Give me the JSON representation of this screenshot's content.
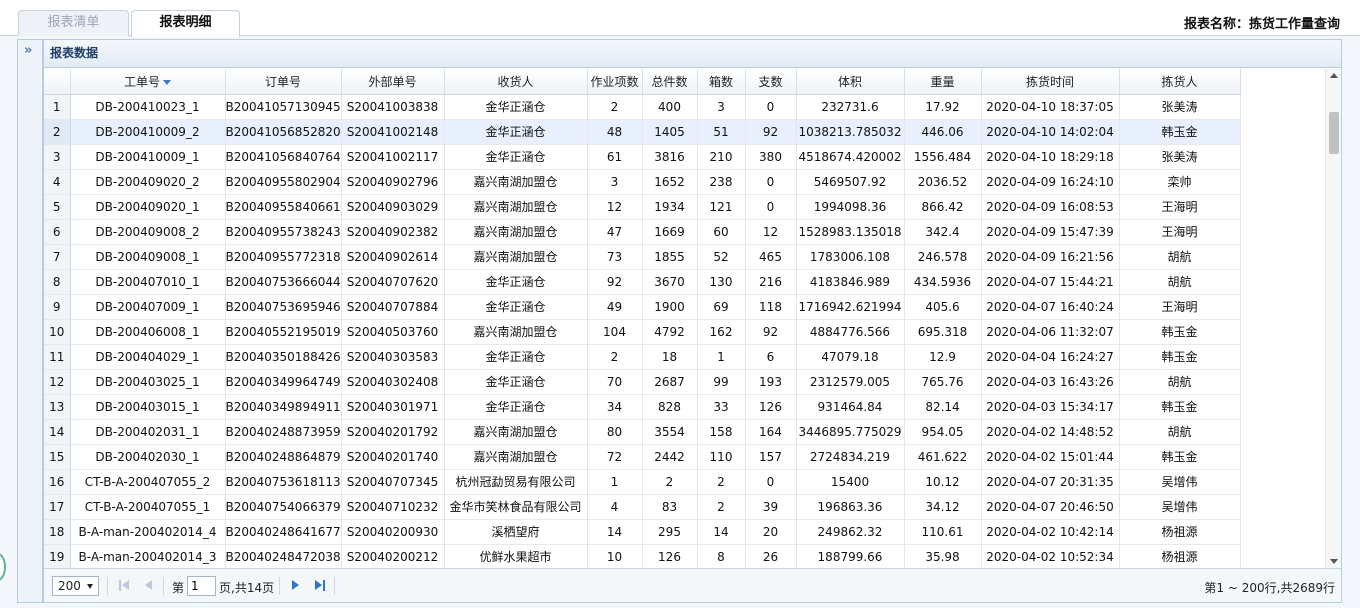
{
  "tabs": [
    {
      "label": "报表清单"
    },
    {
      "label": "报表明细"
    }
  ],
  "report_title": "报表名称：拣货工作量查询",
  "panel": {
    "title": "报表数据"
  },
  "table": {
    "headers": [
      "工单号",
      "订单号",
      "外部单号",
      "收货人",
      "作业项数",
      "总件数",
      "箱数",
      "支数",
      "体积",
      "重量",
      "拣货时间",
      "拣货人"
    ],
    "rows": [
      {
        "n": "1",
        "c": [
          "DB-200410023_1",
          "B20041057130945",
          "S20041003838",
          "金华正涵仓",
          "2",
          "400",
          "3",
          "0",
          "232731.6",
          "17.92",
          "2020-04-10 18:37:05",
          "张美涛"
        ]
      },
      {
        "n": "2",
        "c": [
          "DB-200410009_2",
          "B20041056852820",
          "S20041002148",
          "金华正涵仓",
          "48",
          "1405",
          "51",
          "92",
          "1038213.785032",
          "446.06",
          "2020-04-10 14:02:04",
          "韩玉金"
        ]
      },
      {
        "n": "3",
        "c": [
          "DB-200410009_1",
          "B20041056840764",
          "S20041002117",
          "金华正涵仓",
          "61",
          "3816",
          "210",
          "380",
          "4518674.420002",
          "1556.484",
          "2020-04-10 18:29:18",
          "张美涛"
        ]
      },
      {
        "n": "4",
        "c": [
          "DB-200409020_2",
          "B20040955802904",
          "S20040902796",
          "嘉兴南湖加盟仓",
          "3",
          "1652",
          "238",
          "0",
          "5469507.92",
          "2036.52",
          "2020-04-09 16:24:10",
          "栾帅"
        ]
      },
      {
        "n": "5",
        "c": [
          "DB-200409020_1",
          "B20040955840661",
          "S20040903029",
          "嘉兴南湖加盟仓",
          "12",
          "1934",
          "121",
          "0",
          "1994098.36",
          "866.42",
          "2020-04-09 16:08:53",
          "王海明"
        ]
      },
      {
        "n": "6",
        "c": [
          "DB-200409008_2",
          "B20040955738243",
          "S20040902382",
          "嘉兴南湖加盟仓",
          "47",
          "1669",
          "60",
          "12",
          "1528983.135018",
          "342.4",
          "2020-04-09 15:47:39",
          "王海明"
        ]
      },
      {
        "n": "7",
        "c": [
          "DB-200409008_1",
          "B20040955772318",
          "S20040902614",
          "嘉兴南湖加盟仓",
          "73",
          "1855",
          "52",
          "465",
          "1783006.108",
          "246.578",
          "2020-04-09 16:21:56",
          "胡航"
        ]
      },
      {
        "n": "8",
        "c": [
          "DB-200407010_1",
          "B20040753666044",
          "S20040707620",
          "金华正涵仓",
          "92",
          "3670",
          "130",
          "216",
          "4183846.989",
          "434.5936",
          "2020-04-07 15:44:21",
          "胡航"
        ]
      },
      {
        "n": "9",
        "c": [
          "DB-200407009_1",
          "B20040753695946",
          "S20040707884",
          "金华正涵仓",
          "49",
          "1900",
          "69",
          "118",
          "1716942.621994",
          "405.6",
          "2020-04-07 16:40:24",
          "王海明"
        ]
      },
      {
        "n": "10",
        "c": [
          "DB-200406008_1",
          "B20040552195019",
          "S20040503760",
          "嘉兴南湖加盟仓",
          "104",
          "4792",
          "162",
          "92",
          "4884776.566",
          "695.318",
          "2020-04-06 11:32:07",
          "韩玉金"
        ]
      },
      {
        "n": "11",
        "c": [
          "DB-200404029_1",
          "B20040350188426",
          "S20040303583",
          "金华正涵仓",
          "2",
          "18",
          "1",
          "6",
          "47079.18",
          "12.9",
          "2020-04-04 16:24:27",
          "韩玉金"
        ]
      },
      {
        "n": "12",
        "c": [
          "DB-200403025_1",
          "B20040349964749",
          "S20040302408",
          "金华正涵仓",
          "70",
          "2687",
          "99",
          "193",
          "2312579.005",
          "765.76",
          "2020-04-03 16:43:26",
          "胡航"
        ]
      },
      {
        "n": "13",
        "c": [
          "DB-200403015_1",
          "B20040349894911",
          "S20040301971",
          "金华正涵仓",
          "34",
          "828",
          "33",
          "126",
          "931464.84",
          "82.14",
          "2020-04-03 15:34:17",
          "韩玉金"
        ]
      },
      {
        "n": "14",
        "c": [
          "DB-200402031_1",
          "B20040248873959",
          "S20040201792",
          "嘉兴南湖加盟仓",
          "80",
          "3554",
          "158",
          "164",
          "3446895.775029",
          "954.05",
          "2020-04-02 14:48:52",
          "胡航"
        ]
      },
      {
        "n": "15",
        "c": [
          "DB-200402030_1",
          "B20040248864879",
          "S20040201740",
          "嘉兴南湖加盟仓",
          "72",
          "2442",
          "110",
          "157",
          "2724834.219",
          "461.622",
          "2020-04-02 15:01:44",
          "韩玉金"
        ]
      },
      {
        "n": "16",
        "c": [
          "CT-B-A-200407055_2",
          "B20040753618113",
          "S20040707345",
          "杭州冠勐贸易有限公司",
          "1",
          "2",
          "2",
          "0",
          "15400",
          "10.12",
          "2020-04-07 20:31:35",
          "吴增伟"
        ]
      },
      {
        "n": "17",
        "c": [
          "CT-B-A-200407055_1",
          "B20040754066379",
          "S20040710232",
          "金华市笑林食品有限公司",
          "4",
          "83",
          "2",
          "39",
          "196863.36",
          "34.12",
          "2020-04-07 20:46:50",
          "吴增伟"
        ]
      },
      {
        "n": "18",
        "c": [
          "B-A-man-200402014_4",
          "B20040248641677",
          "S20040200930",
          "溪栖望府",
          "14",
          "295",
          "14",
          "20",
          "249862.32",
          "110.61",
          "2020-04-02 10:42:14",
          "杨祖源"
        ]
      },
      {
        "n": "19",
        "c": [
          "B-A-man-200402014_3",
          "B20040248472038",
          "S20040200212",
          "优鲜水果超市",
          "10",
          "126",
          "8",
          "26",
          "188799.66",
          "35.98",
          "2020-04-02 10:52:34",
          "杨祖源"
        ]
      }
    ]
  },
  "pager": {
    "page_size": "200",
    "page_label": "第",
    "page_value": "1",
    "total_pages_label": "页,共14页",
    "info": "第1 ~ 200行,共2689行"
  },
  "colors": {
    "accent": "#2f76c9",
    "selected_row": "#e7f0fc",
    "header_text": "#1f3f66"
  }
}
